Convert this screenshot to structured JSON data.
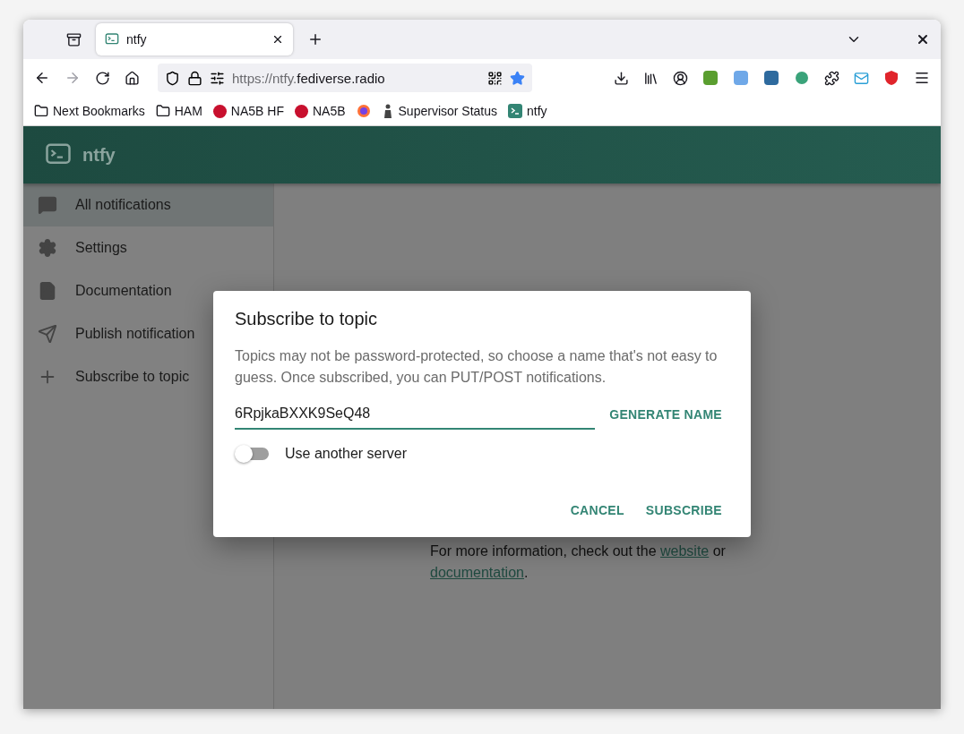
{
  "browser": {
    "tabs": [
      {
        "label": "ntfy",
        "selected": true
      }
    ],
    "url": {
      "scheme": "https://ntfy.",
      "domain": "fediverse.radio"
    },
    "bookmarks": [
      {
        "kind": "folder",
        "label": "Next Bookmarks"
      },
      {
        "kind": "folder",
        "label": "HAM"
      },
      {
        "kind": "rx",
        "label": "NA5B HF"
      },
      {
        "kind": "rx",
        "label": "NA5B"
      },
      {
        "kind": "globe"
      },
      {
        "kind": "figure",
        "label": "Supervisor Status"
      },
      {
        "kind": "ntfy",
        "label": "ntfy"
      }
    ]
  },
  "app": {
    "title": "ntfy",
    "nav": [
      {
        "label": "All notifications",
        "selected": true
      },
      {
        "label": "Settings",
        "selected": false
      },
      {
        "label": "Documentation",
        "selected": false
      },
      {
        "label": "Publish notification",
        "selected": false
      },
      {
        "label": "Subscribe to topic",
        "selected": false
      }
    ],
    "info": {
      "before": "For more information, check out the ",
      "link_1": "website",
      "middle": " or",
      "link_2": "documentation",
      "after": "."
    }
  },
  "dialog": {
    "title": "Subscribe to topic",
    "description": "Topics may not be password-protected, so choose a name that's not easy to guess. Once subscribed, you can PUT/POST notifications.",
    "topic_field": {
      "value": "6RpjkaBXXK9SeQ48"
    },
    "generate_button": "GENERATE NAME",
    "server_toggle": {
      "label": "Use another server",
      "on": false
    },
    "buttons": [
      "CANCEL",
      "SUBSCRIBE"
    ]
  }
}
